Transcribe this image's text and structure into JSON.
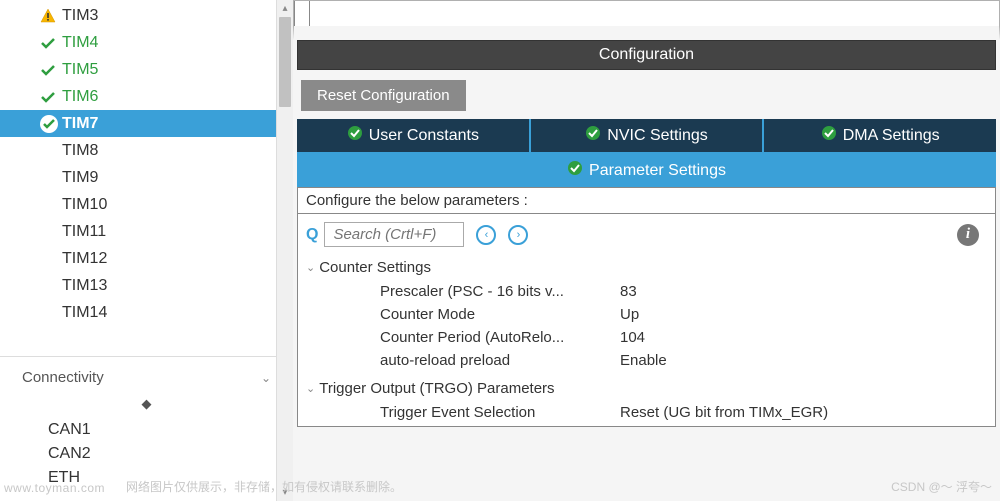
{
  "sidebar": {
    "items": [
      {
        "label": "TIM3",
        "state": "warn"
      },
      {
        "label": "TIM4",
        "state": "ok"
      },
      {
        "label": "TIM5",
        "state": "ok"
      },
      {
        "label": "TIM6",
        "state": "ok"
      },
      {
        "label": "TIM7",
        "state": "selected"
      },
      {
        "label": "TIM8",
        "state": "plain"
      },
      {
        "label": "TIM9",
        "state": "plain"
      },
      {
        "label": "TIM10",
        "state": "plain"
      },
      {
        "label": "TIM11",
        "state": "plain"
      },
      {
        "label": "TIM12",
        "state": "plain"
      },
      {
        "label": "TIM13",
        "state": "plain"
      },
      {
        "label": "TIM14",
        "state": "plain"
      }
    ],
    "category": "Connectivity",
    "conn_items": [
      {
        "label": "CAN1"
      },
      {
        "label": "CAN2"
      },
      {
        "label": "ETH"
      }
    ]
  },
  "config": {
    "header": "Configuration",
    "reset_label": "Reset Configuration",
    "tabs_top": [
      {
        "label": "User Constants"
      },
      {
        "label": "NVIC Settings"
      },
      {
        "label": "DMA Settings"
      }
    ],
    "tab_active": "Parameter Settings",
    "panel_title": "Configure the below parameters :",
    "search_placeholder": "Search (Crtl+F)",
    "groups": [
      {
        "title": "Counter Settings",
        "params": [
          {
            "label": "Prescaler (PSC - 16 bits v...",
            "value": "83"
          },
          {
            "label": "Counter Mode",
            "value": "Up"
          },
          {
            "label": "Counter Period (AutoRelo...",
            "value": "104"
          },
          {
            "label": "auto-reload preload",
            "value": "Enable"
          }
        ]
      },
      {
        "title": "Trigger Output (TRGO) Parameters",
        "params": [
          {
            "label": "Trigger Event Selection",
            "value": "Reset (UG bit from TIMx_EGR)"
          }
        ]
      }
    ]
  },
  "watermark": {
    "left": "www.toyman.com",
    "center": "网络图片仅供展示，非存储，如有侵权请联系删除。",
    "right": "CSDN @～ 浮夸～"
  }
}
